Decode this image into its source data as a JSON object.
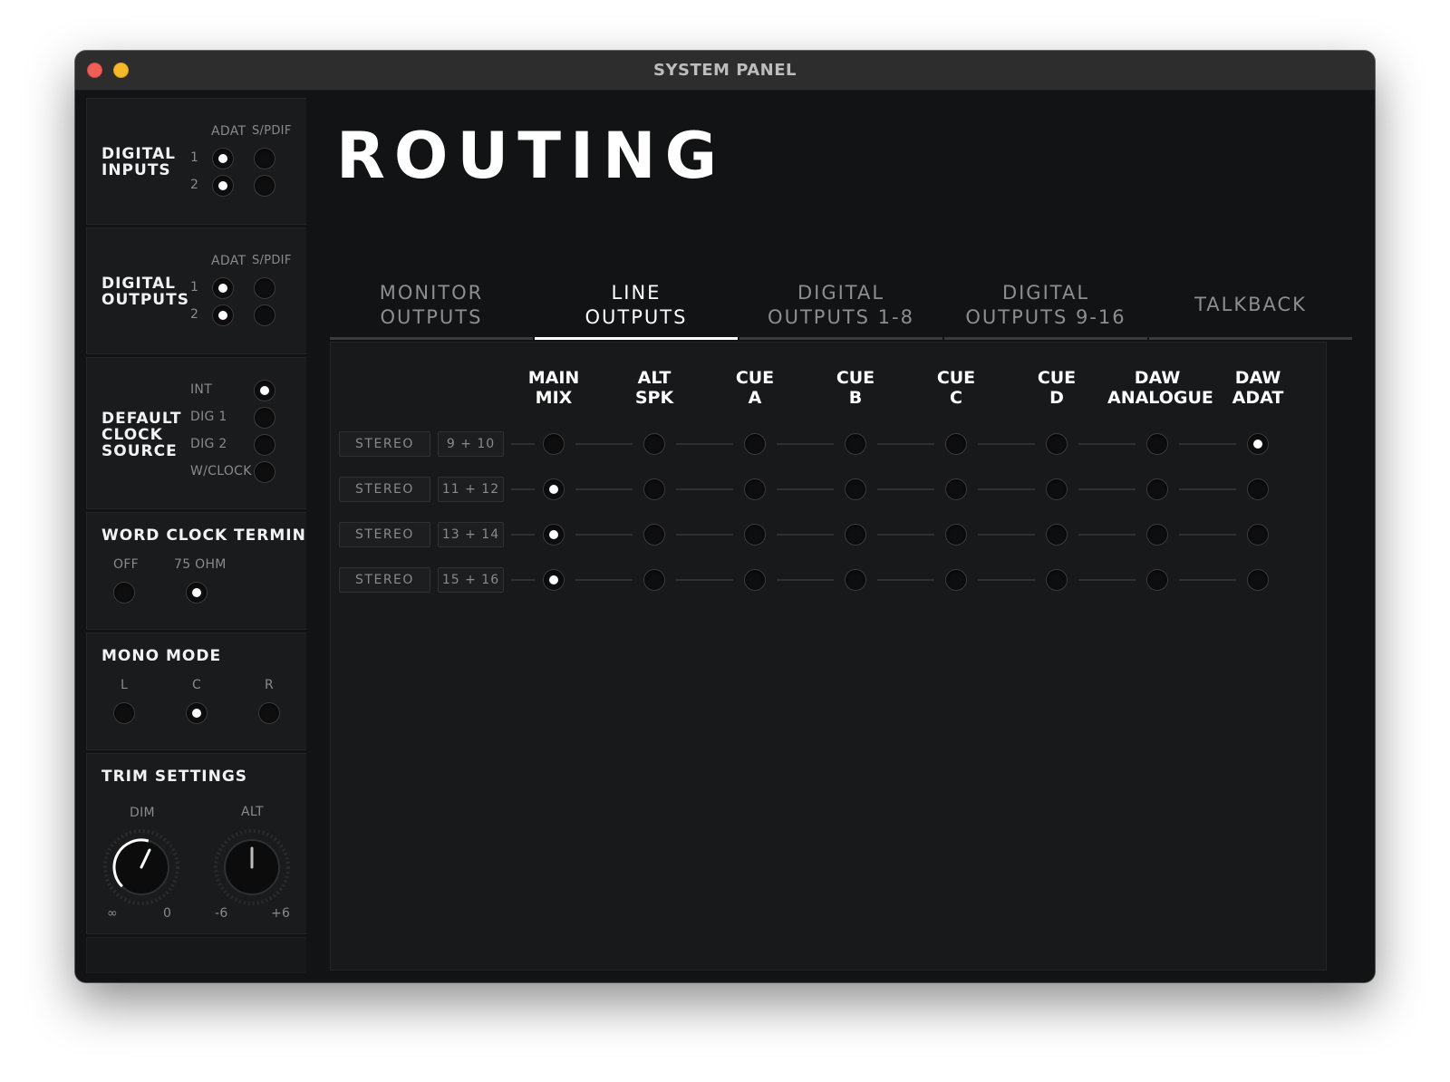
{
  "window": {
    "title": "SYSTEM PANEL"
  },
  "sidebar": {
    "digital_inputs": {
      "label": "DIGITAL\nINPUTS",
      "col_adat": "ADAT",
      "col_spdif": "S/PDIF",
      "rows": [
        {
          "label": "1",
          "adat": true,
          "spdif": false
        },
        {
          "label": "2",
          "adat": true,
          "spdif": false
        }
      ]
    },
    "digital_outputs": {
      "label": "DIGITAL\nOUTPUTS",
      "col_adat": "ADAT",
      "col_spdif": "S/PDIF",
      "rows": [
        {
          "label": "1",
          "adat": true,
          "spdif": false
        },
        {
          "label": "2",
          "adat": true,
          "spdif": false
        }
      ]
    },
    "clock_source": {
      "label": "DEFAULT\nCLOCK\nSOURCE",
      "options": [
        {
          "label": "INT",
          "selected": true
        },
        {
          "label": "DIG 1",
          "selected": false
        },
        {
          "label": "DIG 2",
          "selected": false
        },
        {
          "label": "W/CLOCK",
          "selected": false
        }
      ]
    },
    "word_clock": {
      "label": "WORD CLOCK TERMINATE",
      "options": [
        {
          "label": "OFF",
          "selected": false
        },
        {
          "label": "75 OHM",
          "selected": true
        }
      ]
    },
    "mono_mode": {
      "label": "MONO MODE",
      "options": [
        {
          "label": "L",
          "selected": false
        },
        {
          "label": "C",
          "selected": true
        },
        {
          "label": "R",
          "selected": false
        }
      ]
    },
    "trim": {
      "label": "TRIM SETTINGS",
      "dim": {
        "label": "DIM",
        "min": "∞",
        "max": "0"
      },
      "alt": {
        "label": "ALT",
        "min": "-6",
        "max": "+6"
      }
    }
  },
  "main": {
    "title": "ROUTING",
    "tabs": [
      {
        "label": "MONITOR\nOUTPUTS",
        "active": false
      },
      {
        "label": "LINE\nOUTPUTS",
        "active": true
      },
      {
        "label": "DIGITAL\nOUTPUTS 1-8",
        "active": false
      },
      {
        "label": "DIGITAL\nOUTPUTS 9-16",
        "active": false
      },
      {
        "label": "TALKBACK",
        "active": false
      }
    ],
    "columns": [
      "MAIN\nMIX",
      "ALT\nSPK",
      "CUE\nA",
      "CUE\nB",
      "CUE\nC",
      "CUE\nD",
      "DAW\nANALOGUE",
      "DAW\nADAT"
    ],
    "rows": [
      {
        "mode": "STEREO",
        "channels": "9 + 10",
        "selected": 7
      },
      {
        "mode": "STEREO",
        "channels": "11 + 12",
        "selected": 0
      },
      {
        "mode": "STEREO",
        "channels": "13 + 14",
        "selected": 0
      },
      {
        "mode": "STEREO",
        "channels": "15 + 16",
        "selected": 0
      }
    ]
  }
}
